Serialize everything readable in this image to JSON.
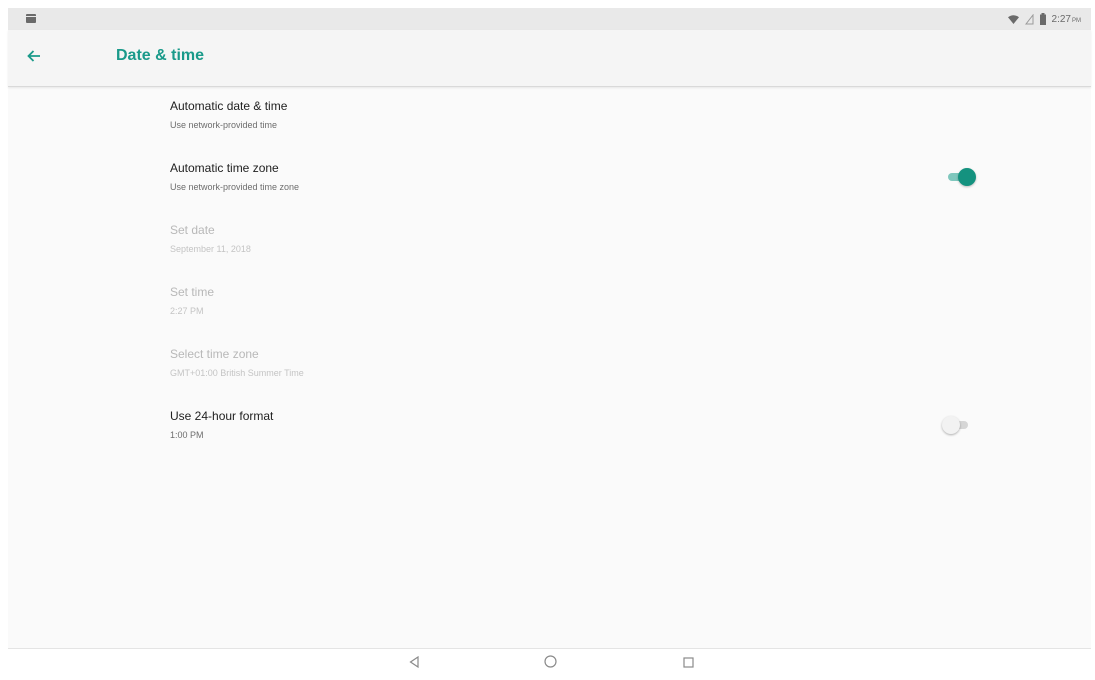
{
  "status_bar": {
    "time": "2:27",
    "time_suffix": "PM",
    "icons": [
      "notification-icon",
      "wifi-icon",
      "signal-icon",
      "battery-icon"
    ]
  },
  "app_bar": {
    "title": "Date & time",
    "back_icon": "arrow-back-icon",
    "accent_color": "#1a9a8a"
  },
  "settings": [
    {
      "title": "Automatic date & time",
      "subtitle": "Use network-provided time",
      "enabled": true
    },
    {
      "title": "Automatic time zone",
      "subtitle": "Use network-provided time zone",
      "enabled": true,
      "toggle": "on"
    },
    {
      "title": "Set date",
      "subtitle": "September 11, 2018",
      "enabled": false
    },
    {
      "title": "Set time",
      "subtitle": "2:27 PM",
      "enabled": false
    },
    {
      "title": "Select time zone",
      "subtitle": "GMT+01:00 British Summer Time",
      "enabled": false
    },
    {
      "title": "Use 24-hour format",
      "subtitle": "1:00 PM",
      "enabled": true,
      "toggle": "off"
    }
  ],
  "nav_bar": {
    "buttons": [
      "back-triangle-icon",
      "home-circle-icon",
      "recents-square-icon"
    ]
  },
  "colors": {
    "toggle_on_thumb": "#14927f",
    "toggle_on_track": "#7fc7bd",
    "toggle_off_thumb": "#f2f2f2",
    "toggle_off_track": "#d6d6d6"
  }
}
